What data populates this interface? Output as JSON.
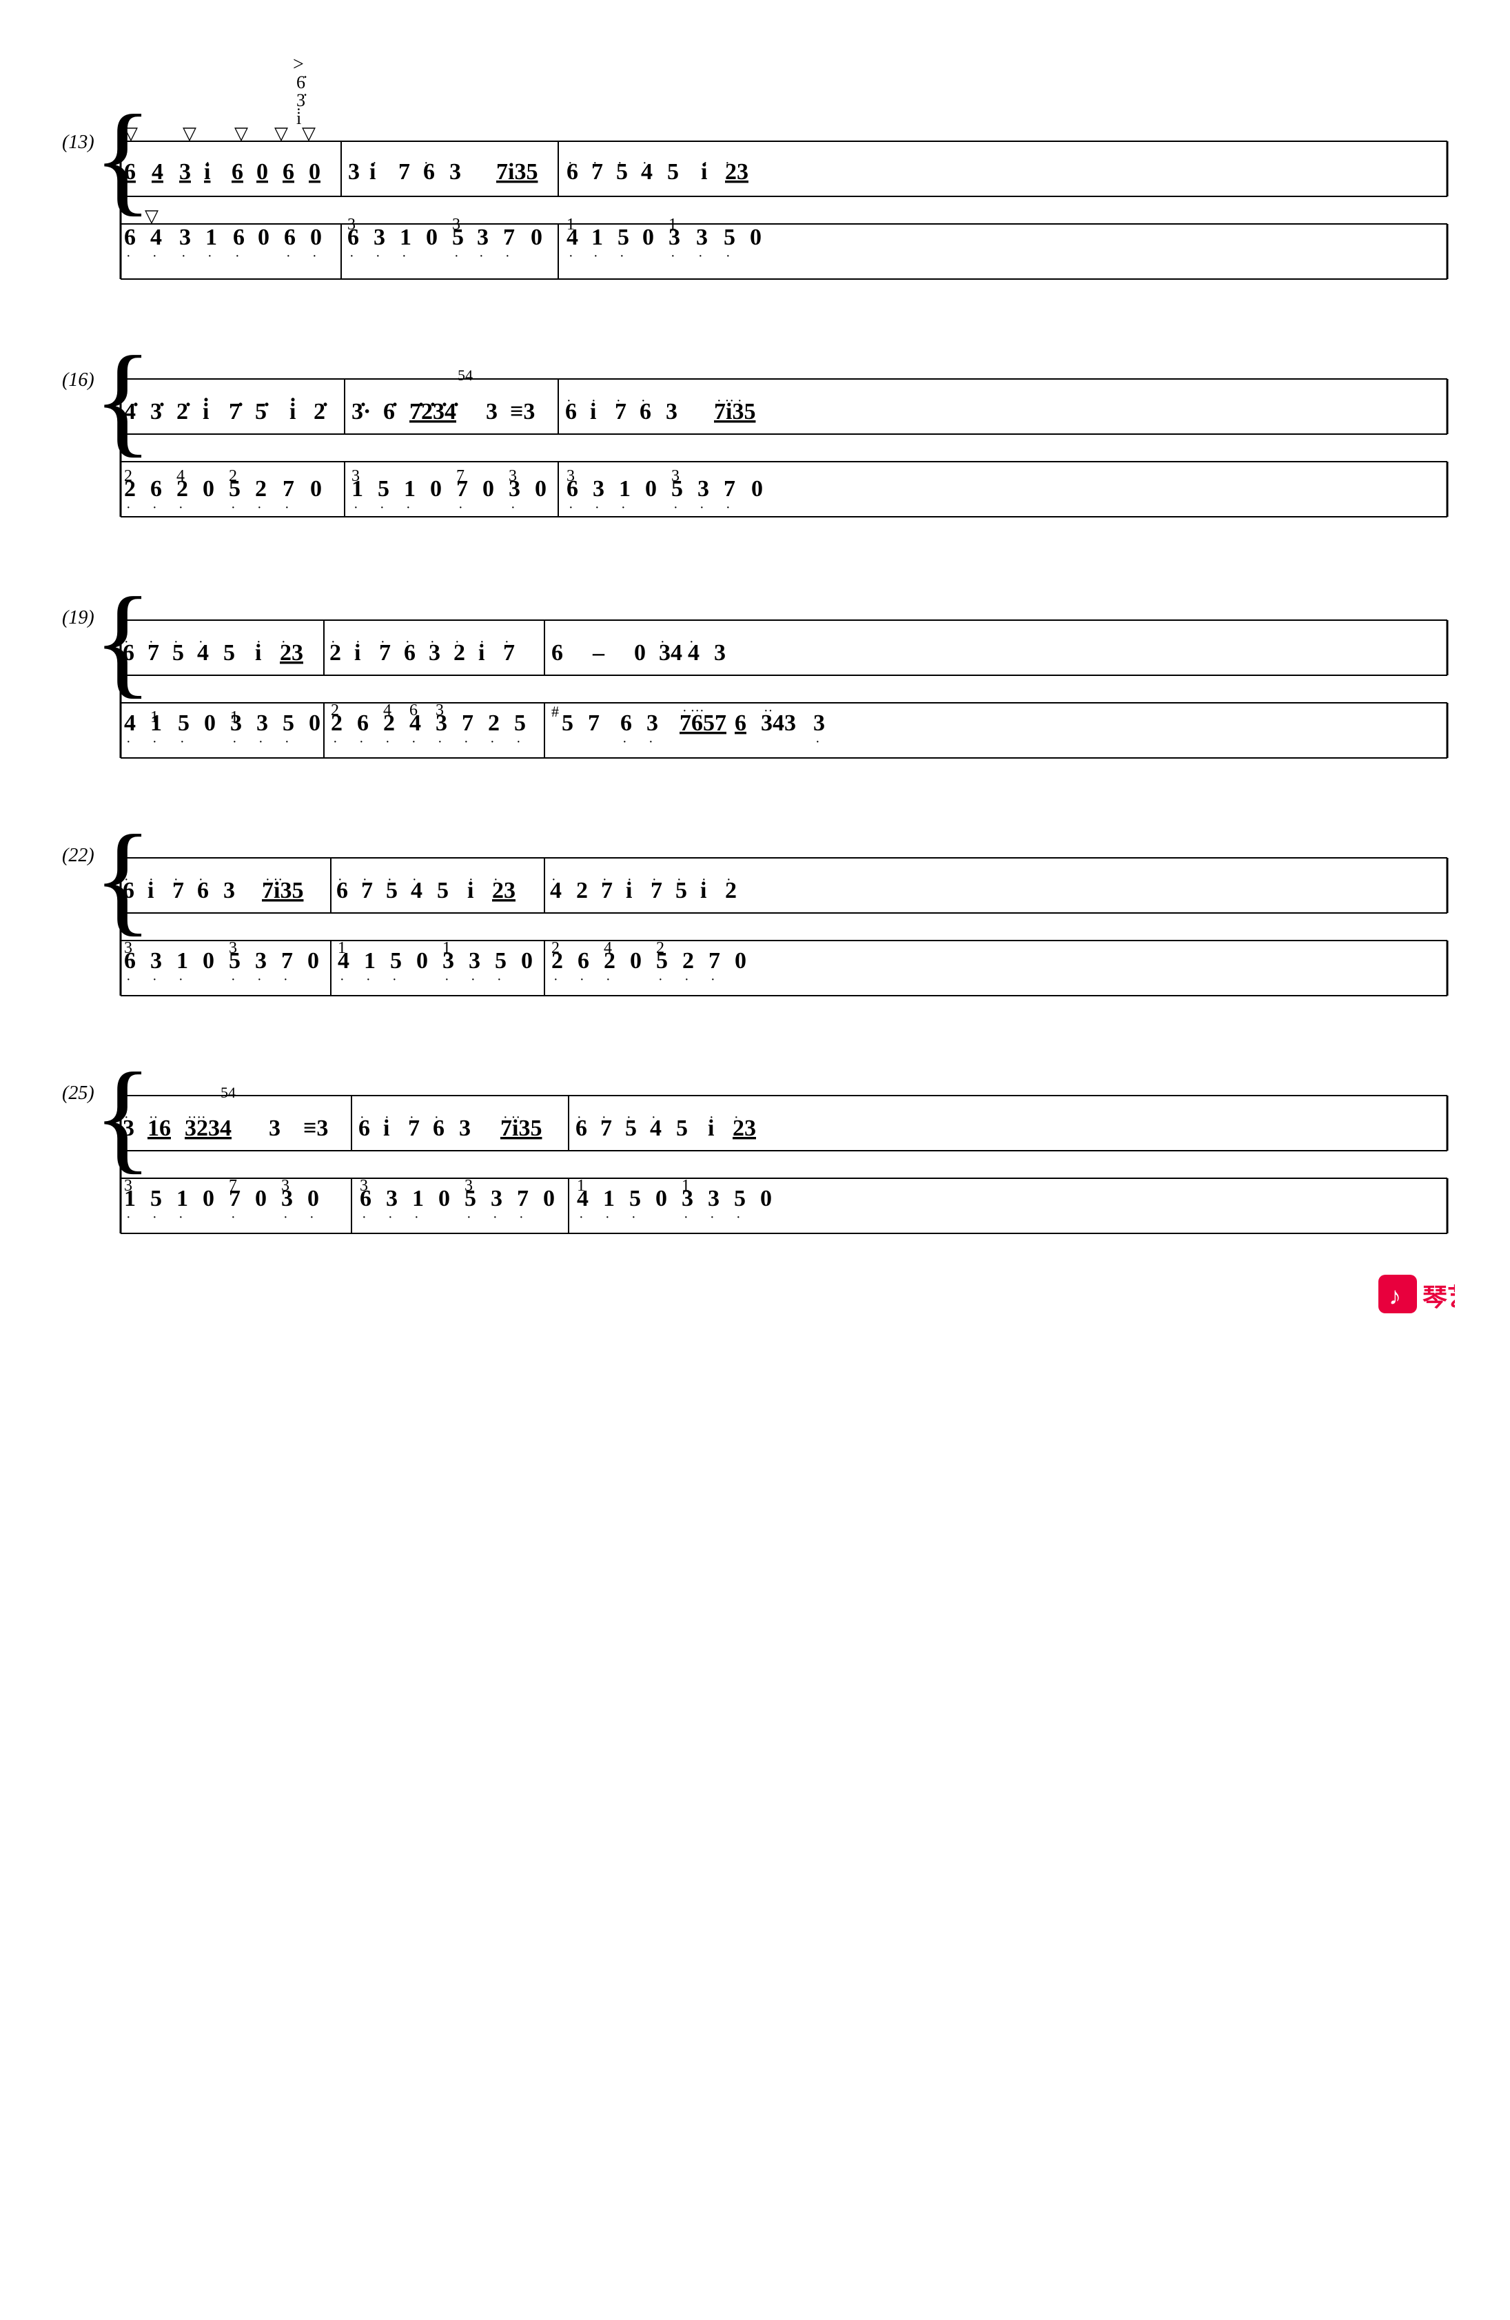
{
  "score": {
    "systems": [
      {
        "number": "(13)",
        "measures": 3
      },
      {
        "number": "(16)",
        "measures": 3
      },
      {
        "number": "(19)",
        "measures": 3
      },
      {
        "number": "(22)",
        "measures": 3
      },
      {
        "number": "(25)",
        "measures": 3
      }
    ]
  },
  "logo": {
    "text": "琴艺谱"
  }
}
